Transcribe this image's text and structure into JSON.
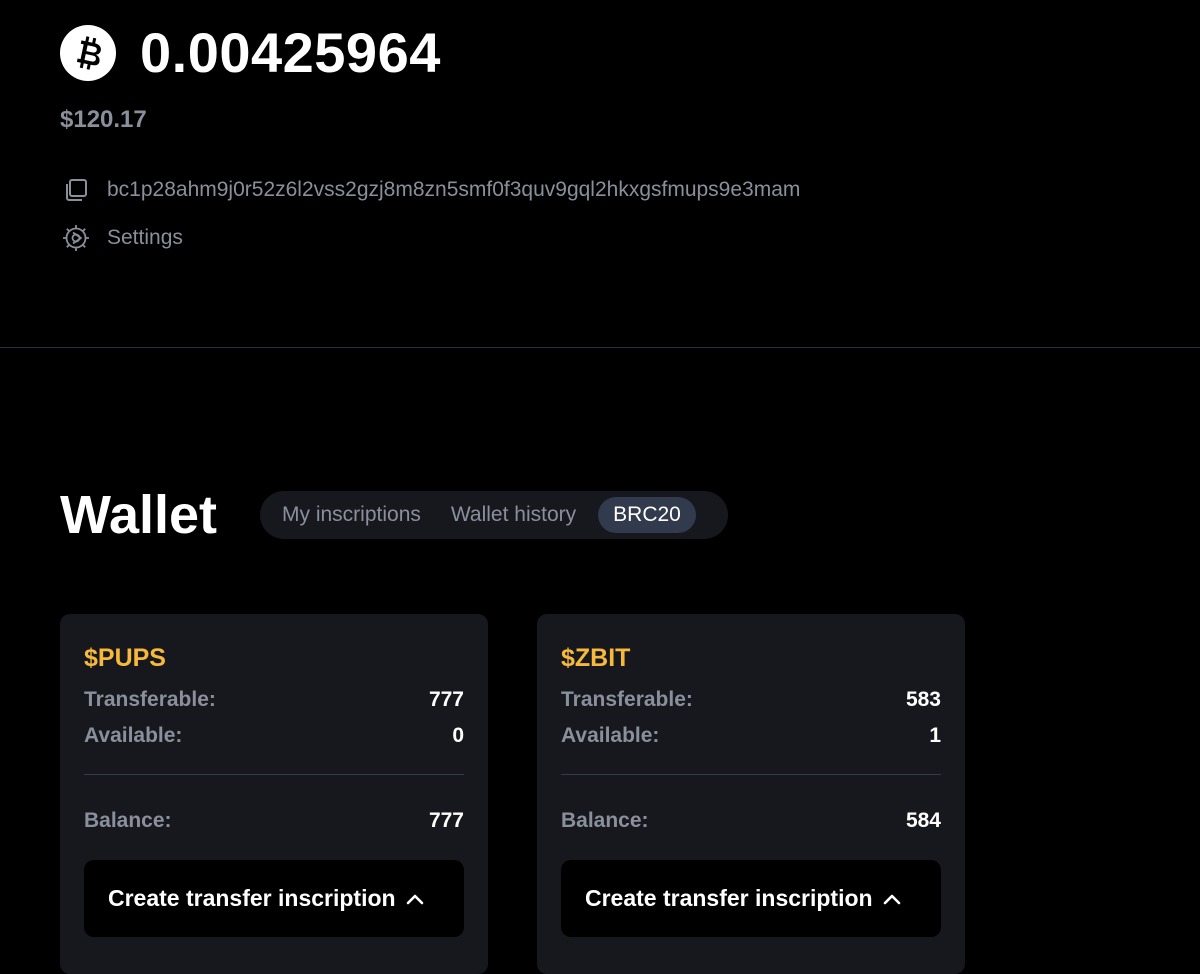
{
  "wallet_header": {
    "coin_icon": "bitcoin-icon",
    "btc_amount": "0.00425964",
    "usd_value": "$120.17",
    "address_icon": "copy-icon",
    "address": "bc1p28ahm9j0r52z6l2vss2gzj8m8zn5smf0f3quv9gql2hkxgsfmups9e3mam",
    "settings_icon": "gear-icon",
    "settings_label": "Settings"
  },
  "wallet": {
    "title": "Wallet",
    "tabs": [
      {
        "label": "My inscriptions",
        "active": false
      },
      {
        "label": "Wallet history",
        "active": false
      },
      {
        "label": "BRC20",
        "active": true
      }
    ]
  },
  "brc20_cards": [
    {
      "ticker": "$PUPS",
      "transferable_label": "Transferable:",
      "transferable": "777",
      "available_label": "Available:",
      "available": "0",
      "balance_label": "Balance:",
      "balance": "777",
      "button_label": "Create transfer inscription",
      "button_icon": "chevron-up-icon"
    },
    {
      "ticker": "$ZBIT",
      "transferable_label": "Transferable:",
      "transferable": "583",
      "available_label": "Available:",
      "available": "1",
      "balance_label": "Balance:",
      "balance": "584",
      "button_label": "Create transfer inscription",
      "button_icon": "chevron-up-icon"
    }
  ],
  "colors": {
    "background": "#000000",
    "card": "#17181d",
    "muted_text": "#8a8f9c",
    "ticker": "#f6b93b",
    "active_tab": "#323a4d"
  }
}
